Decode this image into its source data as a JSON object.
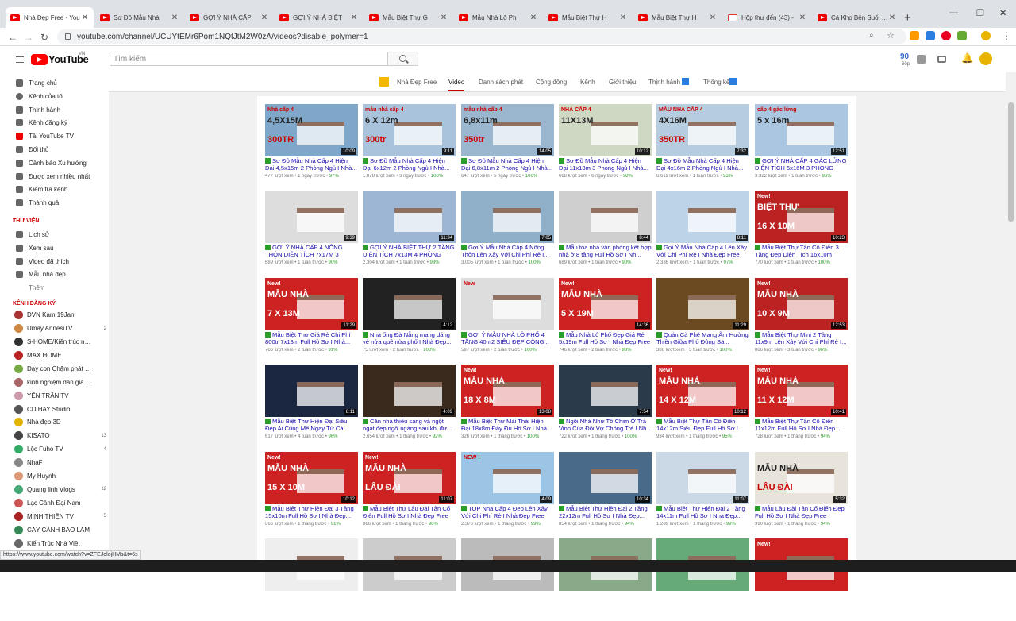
{
  "tabs": [
    {
      "label": "Nhà Đẹp Free - You",
      "icon": "youtube-icon",
      "active": true
    },
    {
      "label": "Sơ Đồ Mẫu Nhà",
      "icon": "youtube-icon"
    },
    {
      "label": "GỢI Ý NHÀ CẤP",
      "icon": "youtube-icon"
    },
    {
      "label": "GỢI Ý NHÀ BIỆT",
      "icon": "youtube-icon"
    },
    {
      "label": "Mẫu Biệt Thự G",
      "icon": "youtube-icon"
    },
    {
      "label": "Mẫu Nhà Lô Ph",
      "icon": "youtube-icon"
    },
    {
      "label": "Mẫu Biệt Thự H",
      "icon": "youtube-icon"
    },
    {
      "label": "Mẫu Biệt Thự H",
      "icon": "youtube-icon"
    },
    {
      "label": "Hộp thư đến (43) -",
      "icon": "gmail-icon"
    },
    {
      "label": "Cá Kho Bên Suối Lạ",
      "icon": "youtube-icon"
    }
  ],
  "address": {
    "url": "youtube.com/channel/UCUYtEMr6Pom1NQtJtM2W0zA/videos?disable_polymer=1"
  },
  "header": {
    "logo_text": "YouTube",
    "region": "VN",
    "search_placeholder": "Tìm kiếm",
    "counter": "90",
    "counter_sub": "60p"
  },
  "sidebar": {
    "main": [
      "Trang chủ",
      "Kênh của tôi",
      "Thịnh hành",
      "Kênh đăng ký",
      "Tải YouTube TV",
      "Đối thủ",
      "Cảnh báo Xu hướng",
      "Được xem nhiều nhất",
      "Kiểm tra kênh",
      "Thành quả"
    ],
    "library_heading": "THƯ VIỆN",
    "library": [
      "Lịch sử",
      "Xem sau",
      "Video đã thích",
      "Mẫu nhà đẹp"
    ],
    "more": "Thêm",
    "subs_heading": "KÊNH ĐĂNG KÝ",
    "subs": [
      {
        "name": "DVN Kam 19Jan",
        "count": ""
      },
      {
        "name": "Umay AnnesiTV",
        "count": "2"
      },
      {
        "name": "S-HOME/Kiến trúc nhà...",
        "count": ""
      },
      {
        "name": "MAX HOME",
        "count": ""
      },
      {
        "name": "Dạy con Chậm phát tri...",
        "count": ""
      },
      {
        "name": "kinh nghiệm dân gian ...",
        "count": ""
      },
      {
        "name": "YẾN TRẦN TV",
        "count": ""
      },
      {
        "name": "CD HAY Studio",
        "count": ""
      },
      {
        "name": "Nhà đẹp 3D",
        "count": ""
      },
      {
        "name": "KISATO",
        "count": "13"
      },
      {
        "name": "Lộc Fuho TV",
        "count": "4"
      },
      {
        "name": "NhaF",
        "count": ""
      },
      {
        "name": "My Huynh",
        "count": ""
      },
      {
        "name": "Quang linh Vlogs",
        "count": "12"
      },
      {
        "name": "Lạc Cảnh Đại Nam",
        "count": ""
      },
      {
        "name": "MINH THIỆN TV",
        "count": "5"
      },
      {
        "name": "CÂY CẢNH BẢO LÂM",
        "count": ""
      },
      {
        "name": "Kiến Trúc Nhà Việt",
        "count": ""
      }
    ]
  },
  "channel_tabs": [
    "Nhà Đẹp Free",
    "Video",
    "Danh sách phát",
    "Cộng đồng",
    "Kênh",
    "Giới thiệu",
    "Thịnh hành",
    "Thống kê"
  ],
  "videos": [
    {
      "title": "Sơ Đồ Mẫu Nhà Cấp 4 Hiện Đại 4,5x15m 2 Phòng Ngủ I Nhà...",
      "views": "477 lượt xem",
      "time": "1 ngày trước",
      "pct": "97%",
      "dur": "10:09",
      "overlay": "Nhà cấp 4",
      "overlay2": "4,5X15M",
      "overlay3": "300TR"
    },
    {
      "title": "Sơ Đồ Mẫu Nhà Cấp 4 Hiện Đại 6x12m 2 Phòng Ngủ I Nhà...",
      "views": "1.878 lượt xem",
      "time": "3 ngày trước",
      "pct": "100%",
      "dur": "9:11",
      "overlay": "mẫu nhà cấp 4",
      "overlay2": "6 X 12m",
      "overlay3": "300tr"
    },
    {
      "title": "Sơ Đồ Mẫu Nhà Cấp 4 Hiện Đại 6,8x11m 2 Phòng Ngủ I Nhà...",
      "views": "647 lượt xem",
      "time": "5 ngày trước",
      "pct": "100%",
      "dur": "14:05",
      "overlay": "mẫu nhà cấp 4",
      "overlay2": "6,8x11m",
      "overlay3": "350tr"
    },
    {
      "title": "Sơ Đồ Mẫu Nhà Cấp 4 Hiện Đại 11x13m 3 Phòng Ngủ I Nhà...",
      "views": "668 lượt xem",
      "time": "6 ngày trước",
      "pct": "98%",
      "dur": "10:12",
      "overlay": "NHÀ CẤP 4",
      "overlay2": "11X13M",
      "overlay3": ""
    },
    {
      "title": "Sơ Đồ Mẫu Nhà Cấp 4 Hiện Đại 4x16m 2 Phòng Ngủ I Nhà...",
      "views": "6.611 lượt xem",
      "time": "1 tuần trước",
      "pct": "93%",
      "dur": "7:32",
      "overlay": "MẪU NHÀ CẤP 4",
      "overlay2": "4X16M",
      "overlay3": "350TR"
    },
    {
      "title": "GỢI Ý NHÀ CẤP 4 GÁC LỬNG DIỆN TÍCH 5x16M 3 PHÒNG NG...",
      "views": "3.322 lượt xem",
      "time": "1 tuần trước",
      "pct": "96%",
      "dur": "12:51",
      "overlay": "cấp 4 gác lửng",
      "overlay2": "5 x 16m",
      "overlay3": ""
    },
    {
      "title": "GỢI Ý NHÀ CẤP 4 NÔNG THÔN DIỆN TÍCH 7x17M 3 PHÒNG...",
      "views": "689 lượt xem",
      "time": "1 tuần trước",
      "pct": "90%",
      "dur": "9:39",
      "overlay": "",
      "overlay2": "",
      "overlay3": ""
    },
    {
      "title": "GỢI Ý NHÀ BIỆT THỰ 2 TẦNG DIỆN TÍCH 7x13M 4 PHÒNG NG...",
      "views": "2.304 lượt xem",
      "time": "1 tuần trước",
      "pct": "93%",
      "dur": "11:34",
      "overlay": "",
      "overlay2": "",
      "overlay3": ""
    },
    {
      "title": "Gợi Ý Mẫu Nhà Cấp 4 Nông Thôn Lên Xây Với Chi Phí Rẻ I...",
      "views": "3.005 lượt xem",
      "time": "1 tuần trước",
      "pct": "100%",
      "dur": "7:05",
      "overlay": "",
      "overlay2": "",
      "overlay3": ""
    },
    {
      "title": "Mẫu tòa nhà văn phòng kết hợp nhà ở 8 tầng Full Hồ Sơ I Nh...",
      "views": "689 lượt xem",
      "time": "1 tuần trước",
      "pct": "90%",
      "dur": "8:44",
      "overlay": "",
      "overlay2": "",
      "overlay3": ""
    },
    {
      "title": "Gợi Ý Mẫu Nhà Cấp 4 Lên Xây Với Chi Phí Rẻ I Nhà Đẹp Free",
      "views": "2.336 lượt xem",
      "time": "1 tuần trước",
      "pct": "97%",
      "dur": "8:11",
      "overlay": "",
      "overlay2": "",
      "overlay3": ""
    },
    {
      "title": "Mẫu Biệt Thự Tân Cổ Điển 3 Tầng Đẹp Diện Tích 16x10m Full...",
      "views": "770 lượt xem",
      "time": "1 tuần trước",
      "pct": "100%",
      "dur": "10:23",
      "overlay": "New!",
      "overlay2": "BIỆT THỰ",
      "overlay3": "16 X 10M"
    },
    {
      "title": "Mẫu Biệt Thự Giá Rẻ Chi Phí 800tr 7x13m Full Hồ Sơ I Nhà...",
      "views": "766 lượt xem",
      "time": "2 tuần trước",
      "pct": "91%",
      "dur": "11:29",
      "overlay": "New!",
      "overlay2": "MẪU NHÀ",
      "overlay3": "7 X 13M"
    },
    {
      "title": "Nhà ống Đà Nẵng mang dáng vẻ nửa quê nửa phố I Nhà Đẹp...",
      "views": "75 lượt xem",
      "time": "2 tuần trước",
      "pct": "100%",
      "dur": "4:12",
      "overlay": "",
      "overlay2": "",
      "overlay3": ""
    },
    {
      "title": "GỢI Ý MẪU NHÀ LÔ PHỐ 4 TẦNG 40m2 SIÊU ĐẸP CÔNG...",
      "views": "597 lượt xem",
      "time": "2 tuần trước",
      "pct": "100%",
      "dur": "",
      "overlay": "New",
      "overlay2": "",
      "overlay3": ""
    },
    {
      "title": "Mẫu Nhà Lô Phố Đẹp Giá Rẻ 5x19m Full Hồ Sơ I Nhà Đẹp Free",
      "views": "746 lượt xem",
      "time": "2 tuần trước",
      "pct": "98%",
      "dur": "14:36",
      "overlay": "New!",
      "overlay2": "MẪU NHÀ",
      "overlay3": "5 X 19M"
    },
    {
      "title": "Quán Cà Phê Mang Âm Hưởng Thiền Giữa Phố Đông Sà...",
      "views": "386 lượt xem",
      "time": "3 tuần trước",
      "pct": "100%",
      "dur": "11:29",
      "overlay": "",
      "overlay2": "",
      "overlay3": ""
    },
    {
      "title": "Mẫu Biệt Thự Mini 2 Tầng 11x9m Lên Xây Với Chi Phí Rẻ I...",
      "views": "886 lượt xem",
      "time": "3 tuần trước",
      "pct": "96%",
      "dur": "12:53",
      "overlay": "New!",
      "overlay2": "MẪU NHÀ",
      "overlay3": "10 X 9M"
    },
    {
      "title": "Mẫu Biệt Thự Hiện Đại Siêu Đẹp Ai Cũng Mê Ngay Từ Cái...",
      "views": "617 lượt xem",
      "time": "4 tuần trước",
      "pct": "96%",
      "dur": "8:11",
      "overlay": "",
      "overlay2": "",
      "overlay3": ""
    },
    {
      "title": "Căn nhà thiếu sáng và ngột ngạt đẹp ngỡ ngàng sau khi đư...",
      "views": "2.654 lượt xem",
      "time": "1 tháng trước",
      "pct": "92%",
      "dur": "4:09",
      "overlay": "",
      "overlay2": "",
      "overlay3": ""
    },
    {
      "title": "Mẫu Biệt Thự Mái Thái Hiện Đại 18x8m Đầy Đủ Hồ Sơ I Nhà...",
      "views": "326 lượt xem",
      "time": "1 tháng trước",
      "pct": "100%",
      "dur": "13:08",
      "overlay": "New!",
      "overlay2": "MẪU NHÀ",
      "overlay3": "18 X 8M"
    },
    {
      "title": "Ngôi Nhà Như Tổ Chim Ở Trà Vinh Của Đôi Vợ Chồng Trẻ I Nh...",
      "views": "722 lượt xem",
      "time": "1 tháng trước",
      "pct": "100%",
      "dur": "7:54",
      "overlay": "",
      "overlay2": "",
      "overlay3": ""
    },
    {
      "title": "Mẫu Biệt Thự Tân Cổ Điển 14x12m Siêu Đẹp Full Hồ Sơ I...",
      "views": "934 lượt xem",
      "time": "1 tháng trước",
      "pct": "95%",
      "dur": "10:12",
      "overlay": "New!",
      "overlay2": "MẪU NHÀ",
      "overlay3": "14 X 12M"
    },
    {
      "title": "Mẫu Biệt Thự Tân Cổ Điển 11x12m Full Hồ Sơ I Nhà Đẹp...",
      "views": "728 lượt xem",
      "time": "1 tháng trước",
      "pct": "94%",
      "dur": "10:41",
      "overlay": "New!",
      "overlay2": "MẪU NHÀ",
      "overlay3": "11 X 12M"
    },
    {
      "title": "Mẫu Biệt Thự Hiện Đại 3 Tầng 15x10m Full Hồ Sơ I Nhà Đẹp...",
      "views": "866 lượt xem",
      "time": "1 tháng trước",
      "pct": "91%",
      "dur": "10:12",
      "overlay": "New!",
      "overlay2": "MẪU NHÀ",
      "overlay3": "15 X 10M"
    },
    {
      "title": "Mẫu Biệt Thự Lâu Đài Tân Cổ Điển Full Hồ Sơ I Nhà Đẹp Free",
      "views": "866 lượt xem",
      "time": "1 tháng trước",
      "pct": "96%",
      "dur": "11:07",
      "overlay": "New!",
      "overlay2": "MẪU NHÀ",
      "overlay3": "LÂU ĐÀI"
    },
    {
      "title": "TOP Nhà Cấp 4 Đẹp Lên Xây Với Chi Phí Rẻ I Nhà Đẹp Free",
      "views": "2.376 lượt xem",
      "time": "1 tháng trước",
      "pct": "99%",
      "dur": "4:09",
      "overlay": "NEW !",
      "overlay2": "",
      "overlay3": ""
    },
    {
      "title": "Mẫu Biệt Thự Hiện Đại 2 Tầng 22x12m Full Hồ Sơ I Nhà Đẹp...",
      "views": "854 lượt xem",
      "time": "1 tháng trước",
      "pct": "94%",
      "dur": "10:34",
      "overlay": "",
      "overlay2": "",
      "overlay3": ""
    },
    {
      "title": "Mẫu Biệt Thự Hiện Đại 2 Tầng 14x11m Full Hồ Sơ I Nhà Đẹp...",
      "views": "1.289 lượt xem",
      "time": "1 tháng trước",
      "pct": "99%",
      "dur": "11:07",
      "overlay": "",
      "overlay2": "",
      "overlay3": ""
    },
    {
      "title": "Mẫu Lâu Đài Tân Cổ Điển Đẹp Full Hồ Sơ I Nhà Đẹp Free",
      "views": "390 lượt xem",
      "time": "1 tháng trước",
      "pct": "94%",
      "dur": "5:32",
      "overlay": "",
      "overlay2": "MẪU NHÀ",
      "overlay3": "LÂU ĐÀI"
    },
    {
      "title": "",
      "views": "",
      "time": "",
      "pct": "",
      "dur": "",
      "overlay": "",
      "overlay2": "",
      "overlay3": ""
    },
    {
      "title": "",
      "views": "",
      "time": "",
      "pct": "",
      "dur": "",
      "overlay": "",
      "overlay2": "",
      "overlay3": ""
    },
    {
      "title": "",
      "views": "",
      "time": "",
      "pct": "",
      "dur": "",
      "overlay": "",
      "overlay2": "",
      "overlay3": ""
    },
    {
      "title": "",
      "views": "",
      "time": "",
      "pct": "",
      "dur": "",
      "overlay": "",
      "overlay2": "",
      "overlay3": ""
    },
    {
      "title": "",
      "views": "",
      "time": "",
      "pct": "",
      "dur": "",
      "overlay": "",
      "overlay2": "",
      "overlay3": ""
    },
    {
      "title": "",
      "views": "",
      "time": "",
      "pct": "",
      "dur": "",
      "overlay": "New!",
      "overlay2": "",
      "overlay3": ""
    }
  ],
  "status_url": "https://www.youtube.com/watch?v=ZFEJolojHMs&t=6s",
  "colors": {
    "accent": "#cc0000",
    "link": "#1a0dab",
    "check": "#2a9d2a"
  }
}
